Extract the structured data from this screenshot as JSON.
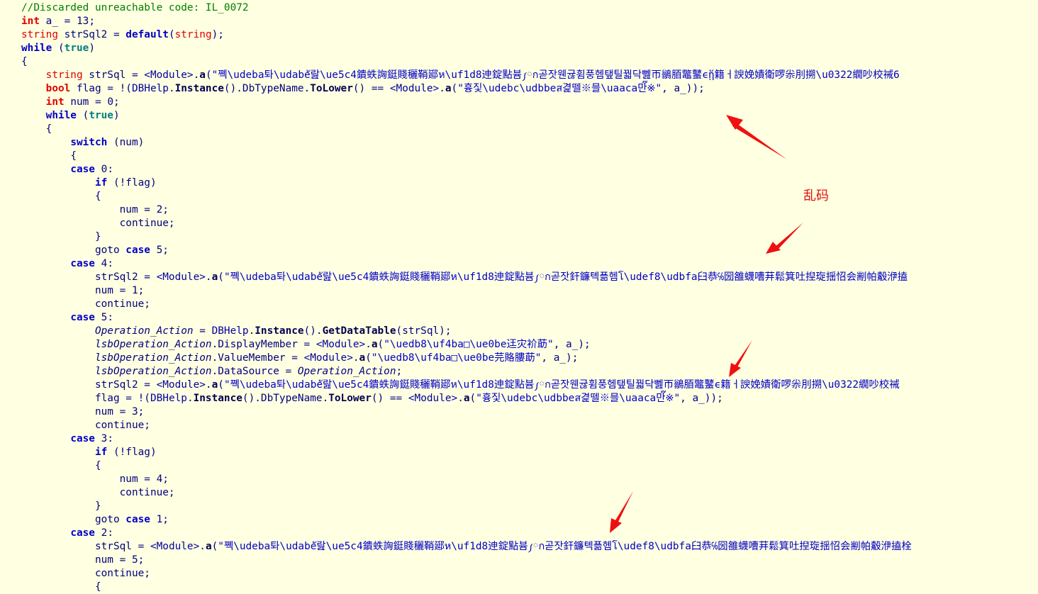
{
  "editor": {
    "annotation_label": "乱码",
    "annotation_color": "#E01010",
    "background": "#FFFFE1",
    "lines": [
      {
        "indent": 0,
        "tokens": [
          [
            "comment",
            "//Discarded unreachable code: IL_0072"
          ]
        ]
      },
      {
        "indent": 0,
        "tokens": [
          [
            "type",
            "int"
          ],
          [
            "plain",
            " a_ = "
          ],
          [
            "num",
            "13"
          ],
          [
            "plain",
            ";"
          ]
        ]
      },
      {
        "indent": 0,
        "tokens": [
          [
            "typel",
            "string"
          ],
          [
            "plain",
            " strSql2 = "
          ],
          [
            "kw",
            "default"
          ],
          [
            "plain",
            "("
          ],
          [
            "typel",
            "string"
          ],
          [
            "plain",
            ");"
          ]
        ]
      },
      {
        "indent": 0,
        "tokens": [
          [
            "kw",
            "while"
          ],
          [
            "plain",
            " ("
          ],
          [
            "lit",
            "true"
          ],
          [
            "plain",
            ")"
          ]
        ]
      },
      {
        "indent": 0,
        "tokens": [
          [
            "plain",
            "{"
          ]
        ]
      },
      {
        "indent": 1,
        "tokens": [
          [
            "typel",
            "string"
          ],
          [
            "plain",
            " strSql = "
          ],
          [
            "mod",
            "<Module>"
          ],
          [
            "plain",
            "."
          ],
          [
            "meth",
            "a"
          ],
          [
            "plain",
            "("
          ],
          [
            "str",
            "\"쪡\\udeba톼\\udabeั랊\\ue5c4鐀蛈詾鋌賤穲鞘郔ห\\uf1d8迧錠點븀༿ก곧잣웬귢휨풍헴탶틸꿟닥뻺帀鶲脜鼈鼜ϵᾕ\u0003籍ㅓ諛娩嫧衛啰尜刖搠\\u0322繝吵校祴6"
          ]
        ]
      },
      {
        "indent": 1,
        "tokens": [
          [
            "type",
            "bool"
          ],
          [
            "plain",
            " flag = !("
          ],
          [
            "cls",
            "DBHelp"
          ],
          [
            "plain",
            "."
          ],
          [
            "meth",
            "Instance"
          ],
          [
            "plain",
            "()."
          ],
          [
            "plain",
            "DbTypeName"
          ],
          [
            "plain",
            "."
          ],
          [
            "meth",
            "ToLower"
          ],
          [
            "plain",
            "() == "
          ],
          [
            "mod",
            "<Module>"
          ],
          [
            "plain",
            "."
          ],
          [
            "meth",
            "a"
          ],
          [
            "plain",
            "("
          ],
          [
            "str",
            "\"흉짗\\udebc\\udbbeส겵뗄※믈\\uaaca만๊※\""
          ],
          [
            "plain",
            ", a_));"
          ]
        ]
      },
      {
        "indent": 1,
        "tokens": [
          [
            "type",
            "int"
          ],
          [
            "plain",
            " num = "
          ],
          [
            "num",
            "0"
          ],
          [
            "plain",
            ";"
          ]
        ]
      },
      {
        "indent": 1,
        "tokens": [
          [
            "kw",
            "while"
          ],
          [
            "plain",
            " ("
          ],
          [
            "lit",
            "true"
          ],
          [
            "plain",
            ")"
          ]
        ]
      },
      {
        "indent": 1,
        "tokens": [
          [
            "plain",
            "{"
          ]
        ]
      },
      {
        "indent": 2,
        "tokens": [
          [
            "kw",
            "switch"
          ],
          [
            "plain",
            " (num)"
          ]
        ]
      },
      {
        "indent": 2,
        "tokens": [
          [
            "plain",
            "{"
          ]
        ]
      },
      {
        "indent": 2,
        "tokens": [
          [
            "kw",
            "case"
          ],
          [
            "plain",
            " "
          ],
          [
            "num",
            "0"
          ],
          [
            "plain",
            ":"
          ]
        ]
      },
      {
        "indent": 3,
        "tokens": [
          [
            "kw",
            "if"
          ],
          [
            "plain",
            " (!flag)"
          ]
        ]
      },
      {
        "indent": 3,
        "tokens": [
          [
            "plain",
            "{"
          ]
        ]
      },
      {
        "indent": 4,
        "tokens": [
          [
            "plain",
            "num = "
          ],
          [
            "num",
            "2"
          ],
          [
            "plain",
            ";"
          ]
        ]
      },
      {
        "indent": 4,
        "tokens": [
          [
            "plain",
            "continue;"
          ]
        ]
      },
      {
        "indent": 3,
        "tokens": [
          [
            "plain",
            "}"
          ]
        ]
      },
      {
        "indent": 3,
        "tokens": [
          [
            "plain",
            "goto "
          ],
          [
            "kw",
            "case"
          ],
          [
            "plain",
            " "
          ],
          [
            "num",
            "5"
          ],
          [
            "plain",
            ";"
          ]
        ]
      },
      {
        "indent": 2,
        "tokens": [
          [
            "kw",
            "case"
          ],
          [
            "plain",
            " "
          ],
          [
            "num",
            "4"
          ],
          [
            "plain",
            ":"
          ]
        ]
      },
      {
        "indent": 3,
        "tokens": [
          [
            "plain",
            "strSql2 = "
          ],
          [
            "mod",
            "<Module>"
          ],
          [
            "plain",
            "."
          ],
          [
            "meth",
            "a"
          ],
          [
            "plain",
            "("
          ],
          [
            "str",
            "\"쪡\\udeba톼\\udabeั랊\\ue5c4鐀蛈詾鋌賤穲鞘郔ห\\uf1d8迧錠點븀༿ก곧잣釬鐮톅픎헴โ\\udef8\\udbfa臼恭℅圀雒蠛嘈荓鬆箕吐揑琁揺怊会剬帕觳洢搕"
          ]
        ]
      },
      {
        "indent": 3,
        "tokens": [
          [
            "plain",
            "num = "
          ],
          [
            "num",
            "1"
          ],
          [
            "plain",
            ";"
          ]
        ]
      },
      {
        "indent": 3,
        "tokens": [
          [
            "plain",
            "continue;"
          ]
        ]
      },
      {
        "indent": 2,
        "tokens": [
          [
            "kw",
            "case"
          ],
          [
            "plain",
            " "
          ],
          [
            "num",
            "5"
          ],
          [
            "plain",
            ":"
          ]
        ]
      },
      {
        "indent": 3,
        "tokens": [
          [
            "ital",
            "Operation_Action"
          ],
          [
            "plain",
            " = "
          ],
          [
            "cls",
            "DBHelp"
          ],
          [
            "plain",
            "."
          ],
          [
            "meth",
            "Instance"
          ],
          [
            "plain",
            "()."
          ],
          [
            "meth",
            "GetDataTable"
          ],
          [
            "plain",
            "(strSql);"
          ]
        ]
      },
      {
        "indent": 3,
        "tokens": [
          [
            "ital",
            "lsbOperation_Action"
          ],
          [
            "plain",
            ".DisplayMember = "
          ],
          [
            "mod",
            "<Module>"
          ],
          [
            "plain",
            "."
          ],
          [
            "meth",
            "a"
          ],
          [
            "plain",
            "("
          ],
          [
            "str",
            "\"\\uedb8\\uf4ba□\\ue0be迋灾衸莇\""
          ],
          [
            "plain",
            ", a_);"
          ]
        ]
      },
      {
        "indent": 3,
        "tokens": [
          [
            "ital",
            "lsbOperation_Action"
          ],
          [
            "plain",
            ".ValueMember = "
          ],
          [
            "mod",
            "<Module>"
          ],
          [
            "plain",
            "."
          ],
          [
            "meth",
            "a"
          ],
          [
            "plain",
            "("
          ],
          [
            "str",
            "\"\\uedb8\\uf4ba□\\ue0be芫賂膢莇\""
          ],
          [
            "plain",
            ", a_);"
          ]
        ]
      },
      {
        "indent": 3,
        "tokens": [
          [
            "ital",
            "lsbOperation_Action"
          ],
          [
            "plain",
            ".DataSource = "
          ],
          [
            "ital",
            "Operation_Action"
          ],
          [
            "plain",
            ";"
          ]
        ]
      },
      {
        "indent": 3,
        "tokens": [
          [
            "plain",
            "strSql2 = "
          ],
          [
            "mod",
            "<Module>"
          ],
          [
            "plain",
            "."
          ],
          [
            "meth",
            "a"
          ],
          [
            "plain",
            "("
          ],
          [
            "str",
            "\"쪡\\udeba톼\\udabeั랊\\ue5c4鐀蛈詾鋌賤穲鞘郔ห\\uf1d8迧錠點븀༿ก곧잣웬귢휨풍헴탶틸꿟닥뻺帀鶲脜鼈鼜ϵ籍ㅓ諛娩嫧衛啰尜刖搠\\u0322繝吵校祴"
          ]
        ]
      },
      {
        "indent": 3,
        "tokens": [
          [
            "plain",
            "flag = !("
          ],
          [
            "cls",
            "DBHelp"
          ],
          [
            "plain",
            "."
          ],
          [
            "meth",
            "Instance"
          ],
          [
            "plain",
            "()."
          ],
          [
            "plain",
            "DbTypeName"
          ],
          [
            "plain",
            "."
          ],
          [
            "meth",
            "ToLower"
          ],
          [
            "plain",
            "() == "
          ],
          [
            "mod",
            "<Module>"
          ],
          [
            "plain",
            "."
          ],
          [
            "meth",
            "a"
          ],
          [
            "plain",
            "("
          ],
          [
            "str",
            "\"흉짗\\udebc\\udbbeส겵뗄※믈\\uaaca만๊※\""
          ],
          [
            "plain",
            ", a_));"
          ]
        ]
      },
      {
        "indent": 3,
        "tokens": [
          [
            "plain",
            "num = "
          ],
          [
            "num",
            "3"
          ],
          [
            "plain",
            ";"
          ]
        ]
      },
      {
        "indent": 3,
        "tokens": [
          [
            "plain",
            "continue;"
          ]
        ]
      },
      {
        "indent": 2,
        "tokens": [
          [
            "kw",
            "case"
          ],
          [
            "plain",
            " "
          ],
          [
            "num",
            "3"
          ],
          [
            "plain",
            ":"
          ]
        ]
      },
      {
        "indent": 3,
        "tokens": [
          [
            "kw",
            "if"
          ],
          [
            "plain",
            " (!flag)"
          ]
        ]
      },
      {
        "indent": 3,
        "tokens": [
          [
            "plain",
            "{"
          ]
        ]
      },
      {
        "indent": 4,
        "tokens": [
          [
            "plain",
            "num = "
          ],
          [
            "num",
            "4"
          ],
          [
            "plain",
            ";"
          ]
        ]
      },
      {
        "indent": 4,
        "tokens": [
          [
            "plain",
            "continue;"
          ]
        ]
      },
      {
        "indent": 3,
        "tokens": [
          [
            "plain",
            "}"
          ]
        ]
      },
      {
        "indent": 3,
        "tokens": [
          [
            "plain",
            "goto "
          ],
          [
            "kw",
            "case"
          ],
          [
            "plain",
            " "
          ],
          [
            "num",
            "1"
          ],
          [
            "plain",
            ";"
          ]
        ]
      },
      {
        "indent": 2,
        "tokens": [
          [
            "kw",
            "case"
          ],
          [
            "plain",
            " "
          ],
          [
            "num",
            "2"
          ],
          [
            "plain",
            ":"
          ]
        ]
      },
      {
        "indent": 3,
        "tokens": [
          [
            "plain",
            "strSql = "
          ],
          [
            "mod",
            "<Module>"
          ],
          [
            "plain",
            "."
          ],
          [
            "meth",
            "a"
          ],
          [
            "plain",
            "("
          ],
          [
            "str",
            "\"쪡\\udeba톼\\udabeั랊\\ue5c4鐀蛈詾鋌賤穲鞘郔ห\\uf1d8迧錠點븀༿ก곧잣釬鐮톅픎헴โ\\udef8\\udbfa臼恭℅圀雒蠛嘈荓鬆箕吐揑琁揺怊会剬帕觳洢搕栓"
          ]
        ]
      },
      {
        "indent": 3,
        "tokens": [
          [
            "plain",
            "num = "
          ],
          [
            "num",
            "5"
          ],
          [
            "plain",
            ";"
          ]
        ]
      },
      {
        "indent": 3,
        "tokens": [
          [
            "plain",
            "continue;"
          ]
        ]
      },
      {
        "indent": 3,
        "tokens": [
          [
            "plain",
            "{"
          ]
        ]
      }
    ]
  }
}
